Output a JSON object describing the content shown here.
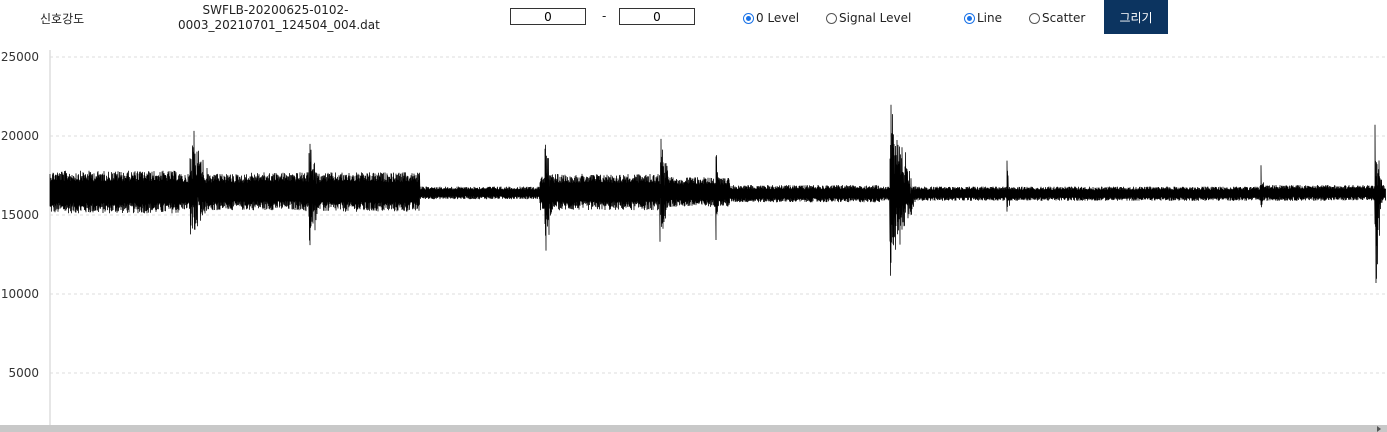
{
  "header": {
    "title_label": "신호강도",
    "filename_line1": "SWFLB-20200625-0102-",
    "filename_line2": "0003_20210701_124504_004.dat",
    "range_start": "0",
    "range_separator": "-",
    "range_end": "0",
    "level_options": [
      {
        "label": "0 Level",
        "selected": true
      },
      {
        "label": "Signal Level",
        "selected": false
      }
    ],
    "style_options": [
      {
        "label": "Line",
        "selected": true
      },
      {
        "label": "Scatter",
        "selected": false
      }
    ],
    "draw_button": "그리기"
  },
  "colors": {
    "accent_button": "#0c3460",
    "radio_selected": "#1a73e8",
    "series": "#000000",
    "grid": "#dddddd"
  },
  "chart_data": {
    "type": "line",
    "title": "",
    "xlabel": "",
    "ylabel": "",
    "ylim": [
      2000,
      25000
    ],
    "xlim": [
      0,
      1336
    ],
    "yticks": [
      25000,
      20000,
      15000,
      10000,
      5000
    ],
    "grid": true,
    "legend": "none",
    "baseline": 16300,
    "series": [
      {
        "name": "",
        "segments": [
          {
            "x0": 0,
            "x1": 130,
            "low": 15100,
            "high": 17800
          },
          {
            "x0": 130,
            "x1": 200,
            "low": 15300,
            "high": 17600
          },
          {
            "x0": 200,
            "x1": 250,
            "low": 15300,
            "high": 17700
          },
          {
            "x0": 250,
            "x1": 370,
            "low": 15200,
            "high": 17700
          },
          {
            "x0": 370,
            "x1": 490,
            "low": 16000,
            "high": 16800
          },
          {
            "x0": 490,
            "x1": 610,
            "low": 15300,
            "high": 17600
          },
          {
            "x0": 610,
            "x1": 680,
            "low": 15500,
            "high": 17400
          },
          {
            "x0": 680,
            "x1": 830,
            "low": 15800,
            "high": 16900
          },
          {
            "x0": 830,
            "x1": 940,
            "low": 15900,
            "high": 16800
          },
          {
            "x0": 940,
            "x1": 1210,
            "low": 15900,
            "high": 16800
          },
          {
            "x0": 1210,
            "x1": 1336,
            "low": 15900,
            "high": 16900
          }
        ],
        "bursts": [
          {
            "x": 140,
            "width": 40,
            "min": 12600,
            "max": 21200
          },
          {
            "x": 259,
            "width": 20,
            "min": 11900,
            "max": 20800
          },
          {
            "x": 495,
            "width": 14,
            "min": 11600,
            "max": 20800
          },
          {
            "x": 610,
            "width": 18,
            "min": 12400,
            "max": 21500
          },
          {
            "x": 666,
            "width": 4,
            "min": 11600,
            "max": 19900
          },
          {
            "x": 840,
            "width": 34,
            "min": 9500,
            "max": 23400
          },
          {
            "x": 957,
            "width": 5,
            "min": 14000,
            "max": 19100
          },
          {
            "x": 1211,
            "width": 5,
            "min": 14800,
            "max": 19000
          },
          {
            "x": 1325,
            "width": 10,
            "min": 9100,
            "max": 22500
          }
        ]
      }
    ]
  }
}
